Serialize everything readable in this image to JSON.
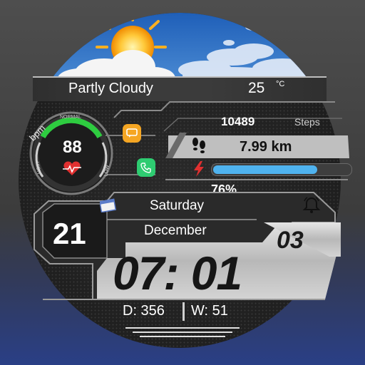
{
  "weather": {
    "condition": "Partly Cloudy",
    "temperature": "25",
    "unit": "°C"
  },
  "heart_rate": {
    "label": "bpm",
    "value": "88",
    "zone_top": "NORMAL",
    "zone_left": "HIGH",
    "zone_right": "LOW"
  },
  "steps": {
    "value": "10489",
    "label": "Steps"
  },
  "distance": {
    "value": "7.99 km"
  },
  "battery": {
    "percent": 76,
    "percent_label": "76%"
  },
  "date": {
    "day": "21",
    "weekday": "Saturday",
    "month": "December"
  },
  "time": {
    "hours_minutes": "07: 01",
    "seconds": "03"
  },
  "counters": {
    "day_of_year": "D: 356",
    "week": "W: 51"
  },
  "icons": [
    "sun-cloud-icon",
    "heart-icon",
    "message-icon",
    "phone-icon",
    "calendar-icon",
    "footsteps-icon",
    "lightning-icon",
    "alarm-icon"
  ],
  "colors": {
    "battery_fill": "#4fb3ef",
    "heart": "#e03030",
    "message_app": "#f5a623",
    "phone_app": "#2ecc71"
  }
}
